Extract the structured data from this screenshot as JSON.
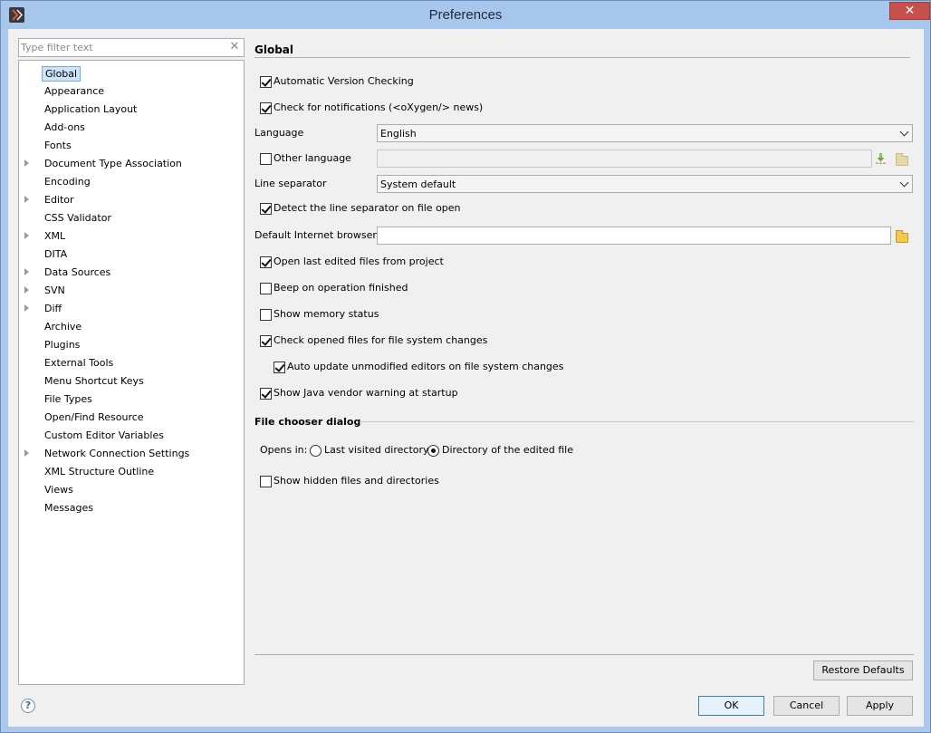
{
  "window": {
    "title": "Preferences",
    "close_glyph": "✕"
  },
  "sidebar": {
    "filter_placeholder": "Type filter text",
    "filter_clear_glyph": "✕",
    "items": [
      {
        "label": "Global",
        "expandable": false,
        "selected": true
      },
      {
        "label": "Appearance",
        "expandable": false
      },
      {
        "label": "Application Layout",
        "expandable": false
      },
      {
        "label": "Add-ons",
        "expandable": false
      },
      {
        "label": "Fonts",
        "expandable": false
      },
      {
        "label": "Document Type Association",
        "expandable": true
      },
      {
        "label": "Encoding",
        "expandable": false
      },
      {
        "label": "Editor",
        "expandable": true
      },
      {
        "label": "CSS Validator",
        "expandable": false
      },
      {
        "label": "XML",
        "expandable": true
      },
      {
        "label": "DITA",
        "expandable": false
      },
      {
        "label": "Data Sources",
        "expandable": true
      },
      {
        "label": "SVN",
        "expandable": true
      },
      {
        "label": "Diff",
        "expandable": true
      },
      {
        "label": "Archive",
        "expandable": false
      },
      {
        "label": "Plugins",
        "expandable": false
      },
      {
        "label": "External Tools",
        "expandable": false
      },
      {
        "label": "Menu Shortcut Keys",
        "expandable": false
      },
      {
        "label": "File Types",
        "expandable": false
      },
      {
        "label": "Open/Find Resource",
        "expandable": false
      },
      {
        "label": "Custom Editor Variables",
        "expandable": false
      },
      {
        "label": "Network Connection Settings",
        "expandable": true
      },
      {
        "label": "XML Structure Outline",
        "expandable": false
      },
      {
        "label": "Views",
        "expandable": false
      },
      {
        "label": "Messages",
        "expandable": false
      }
    ]
  },
  "main": {
    "section_title": "Global",
    "automatic_version_checking": {
      "label": "Automatic Version Checking",
      "checked": true
    },
    "check_notifications": {
      "label": "Check for notifications (<oXygen/> news)",
      "checked": true
    },
    "language": {
      "label": "Language",
      "value": "English"
    },
    "other_language": {
      "label": "Other language",
      "checked": false,
      "value": ""
    },
    "line_separator": {
      "label": "Line separator",
      "value": "System default"
    },
    "detect_line_separator": {
      "label": "Detect the line separator on file open",
      "checked": true
    },
    "default_browser": {
      "label": "Default Internet browser",
      "value": ""
    },
    "open_last_edited": {
      "label": "Open last edited files from project",
      "checked": true
    },
    "beep_on_finish": {
      "label": "Beep on operation finished",
      "checked": false
    },
    "show_memory": {
      "label": "Show memory status",
      "checked": false
    },
    "check_opened_files": {
      "label": "Check opened files for file system changes",
      "checked": true
    },
    "auto_update": {
      "label": "Auto update unmodified editors on file system changes",
      "checked": true
    },
    "java_vendor_warning": {
      "label": "Show Java vendor warning at startup",
      "checked": true
    },
    "file_chooser": {
      "title": "File chooser dialog",
      "opens_in_label": "Opens in:",
      "option_last_visited": "Last visited directory",
      "option_edited_file": "Directory of the edited file",
      "selected": "Directory of the edited file",
      "show_hidden": {
        "label": "Show hidden files and directories",
        "checked": false
      }
    }
  },
  "buttons": {
    "restore_defaults": "Restore Defaults",
    "ok": "OK",
    "cancel": "Cancel",
    "apply": "Apply",
    "help_glyph": "?"
  }
}
